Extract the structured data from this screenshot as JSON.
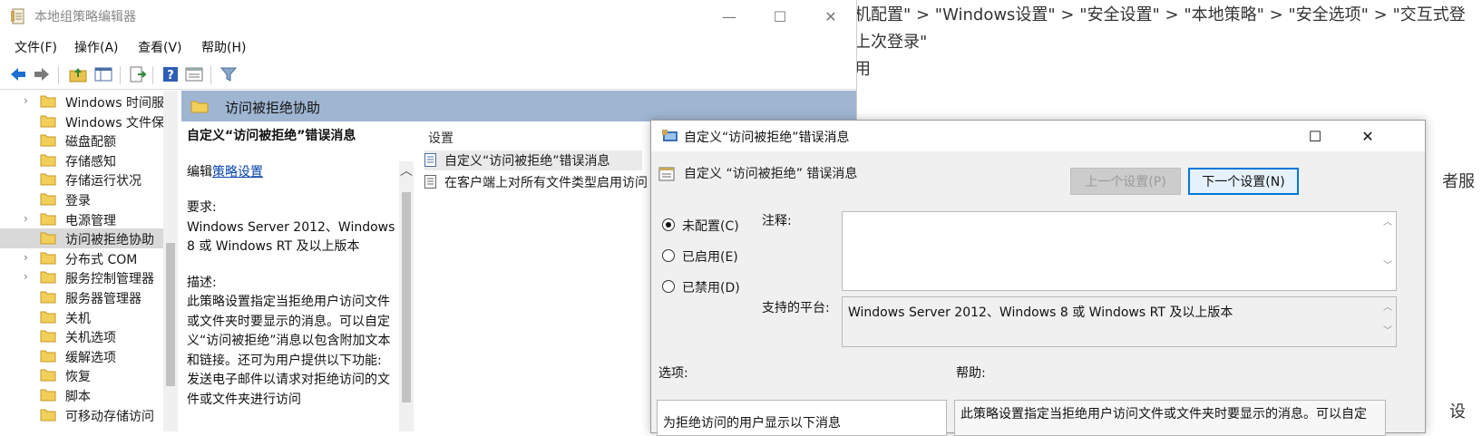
{
  "background_article": {
    "line1": "机配置\" > \"Windows设置\" > \"安全设置\" > \"本地策略\" > \"安全选项\" > \"交互式登",
    "line2": "上次登录\"",
    "line3": "用",
    "fragment_right1": "者服",
    "fragment_right2": "设"
  },
  "window": {
    "title": "本地组策略编辑器",
    "minimize": "—",
    "maximize": "☐",
    "close": "✕"
  },
  "menu": {
    "file": "文件(F)",
    "action": "操作(A)",
    "view": "查看(V)",
    "help": "帮助(H)"
  },
  "toolbar": {
    "icons": [
      "back-arrow-icon",
      "forward-arrow-icon",
      "up-folder-icon",
      "show-hide-tree-icon",
      "export-list-icon",
      "help-icon",
      "properties-icon",
      "filter-icon"
    ]
  },
  "tree": {
    "items": [
      {
        "label": "Windows 时间服",
        "expandable": true
      },
      {
        "label": "Windows 文件保",
        "expandable": false
      },
      {
        "label": "磁盘配额",
        "expandable": false
      },
      {
        "label": "存储感知",
        "expandable": false
      },
      {
        "label": "存储运行状况",
        "expandable": false
      },
      {
        "label": "登录",
        "expandable": false
      },
      {
        "label": "电源管理",
        "expandable": true
      },
      {
        "label": "访问被拒绝协助",
        "expandable": false,
        "selected": true
      },
      {
        "label": "分布式 COM",
        "expandable": true
      },
      {
        "label": "服务控制管理器",
        "expandable": true
      },
      {
        "label": "服务器管理器",
        "expandable": false
      },
      {
        "label": "关机",
        "expandable": false
      },
      {
        "label": "关机选项",
        "expandable": false
      },
      {
        "label": "缓解选项",
        "expandable": false
      },
      {
        "label": "恢复",
        "expandable": false
      },
      {
        "label": "脚本",
        "expandable": false
      },
      {
        "label": "可移动存储访问",
        "expandable": false
      }
    ]
  },
  "right_pane": {
    "header": "访问被拒绝协助",
    "policy_title": "自定义“访问被拒绝”错误消息",
    "edit_prefix": "编辑",
    "edit_link": "策略设置",
    "requirements_label": "要求:",
    "requirements_text": "Windows Server 2012、Windows 8 或 Windows RT 及以上版本",
    "description_label": "描述:",
    "description_text": "此策略设置指定当拒绝用户访问文件或文件夹时要显示的消息。可以自定义“访问被拒绝”消息以包含附加文本和链接。还可为用户提供以下功能: 发送电子邮件以请求对拒绝访问的文件或文件夹进行访问",
    "list_header": "设置",
    "list_items": [
      {
        "label": "自定义“访问被拒绝”错误消息",
        "selected": true
      },
      {
        "label": "在客户端上对所有文件类型启用访问",
        "selected": false
      }
    ]
  },
  "dialog": {
    "title": "自定义“访问被拒绝”错误消息",
    "maximize": "☐",
    "close": "✕",
    "policy_name": "自定义 “访问被拒绝” 错误消息",
    "prev_button": "上一个设置(P)",
    "next_button": "下一个设置(N)",
    "radios": [
      {
        "label": "未配置(C)",
        "checked": true
      },
      {
        "label": "已启用(E)",
        "checked": false
      },
      {
        "label": "已禁用(D)",
        "checked": false
      }
    ],
    "comment_label": "注释:",
    "comment_value": "",
    "platform_label": "支持的平台:",
    "platform_value": "Windows Server 2012、Windows 8 或 Windows RT 及以上版本",
    "options_label": "选项:",
    "help_label": "帮助:",
    "options_first_line": "为拒绝访问的用户显示以下消息",
    "help_first_line": "此策略设置指定当拒绝用户访问文件或文件夹时要显示的消息。可以自定"
  }
}
